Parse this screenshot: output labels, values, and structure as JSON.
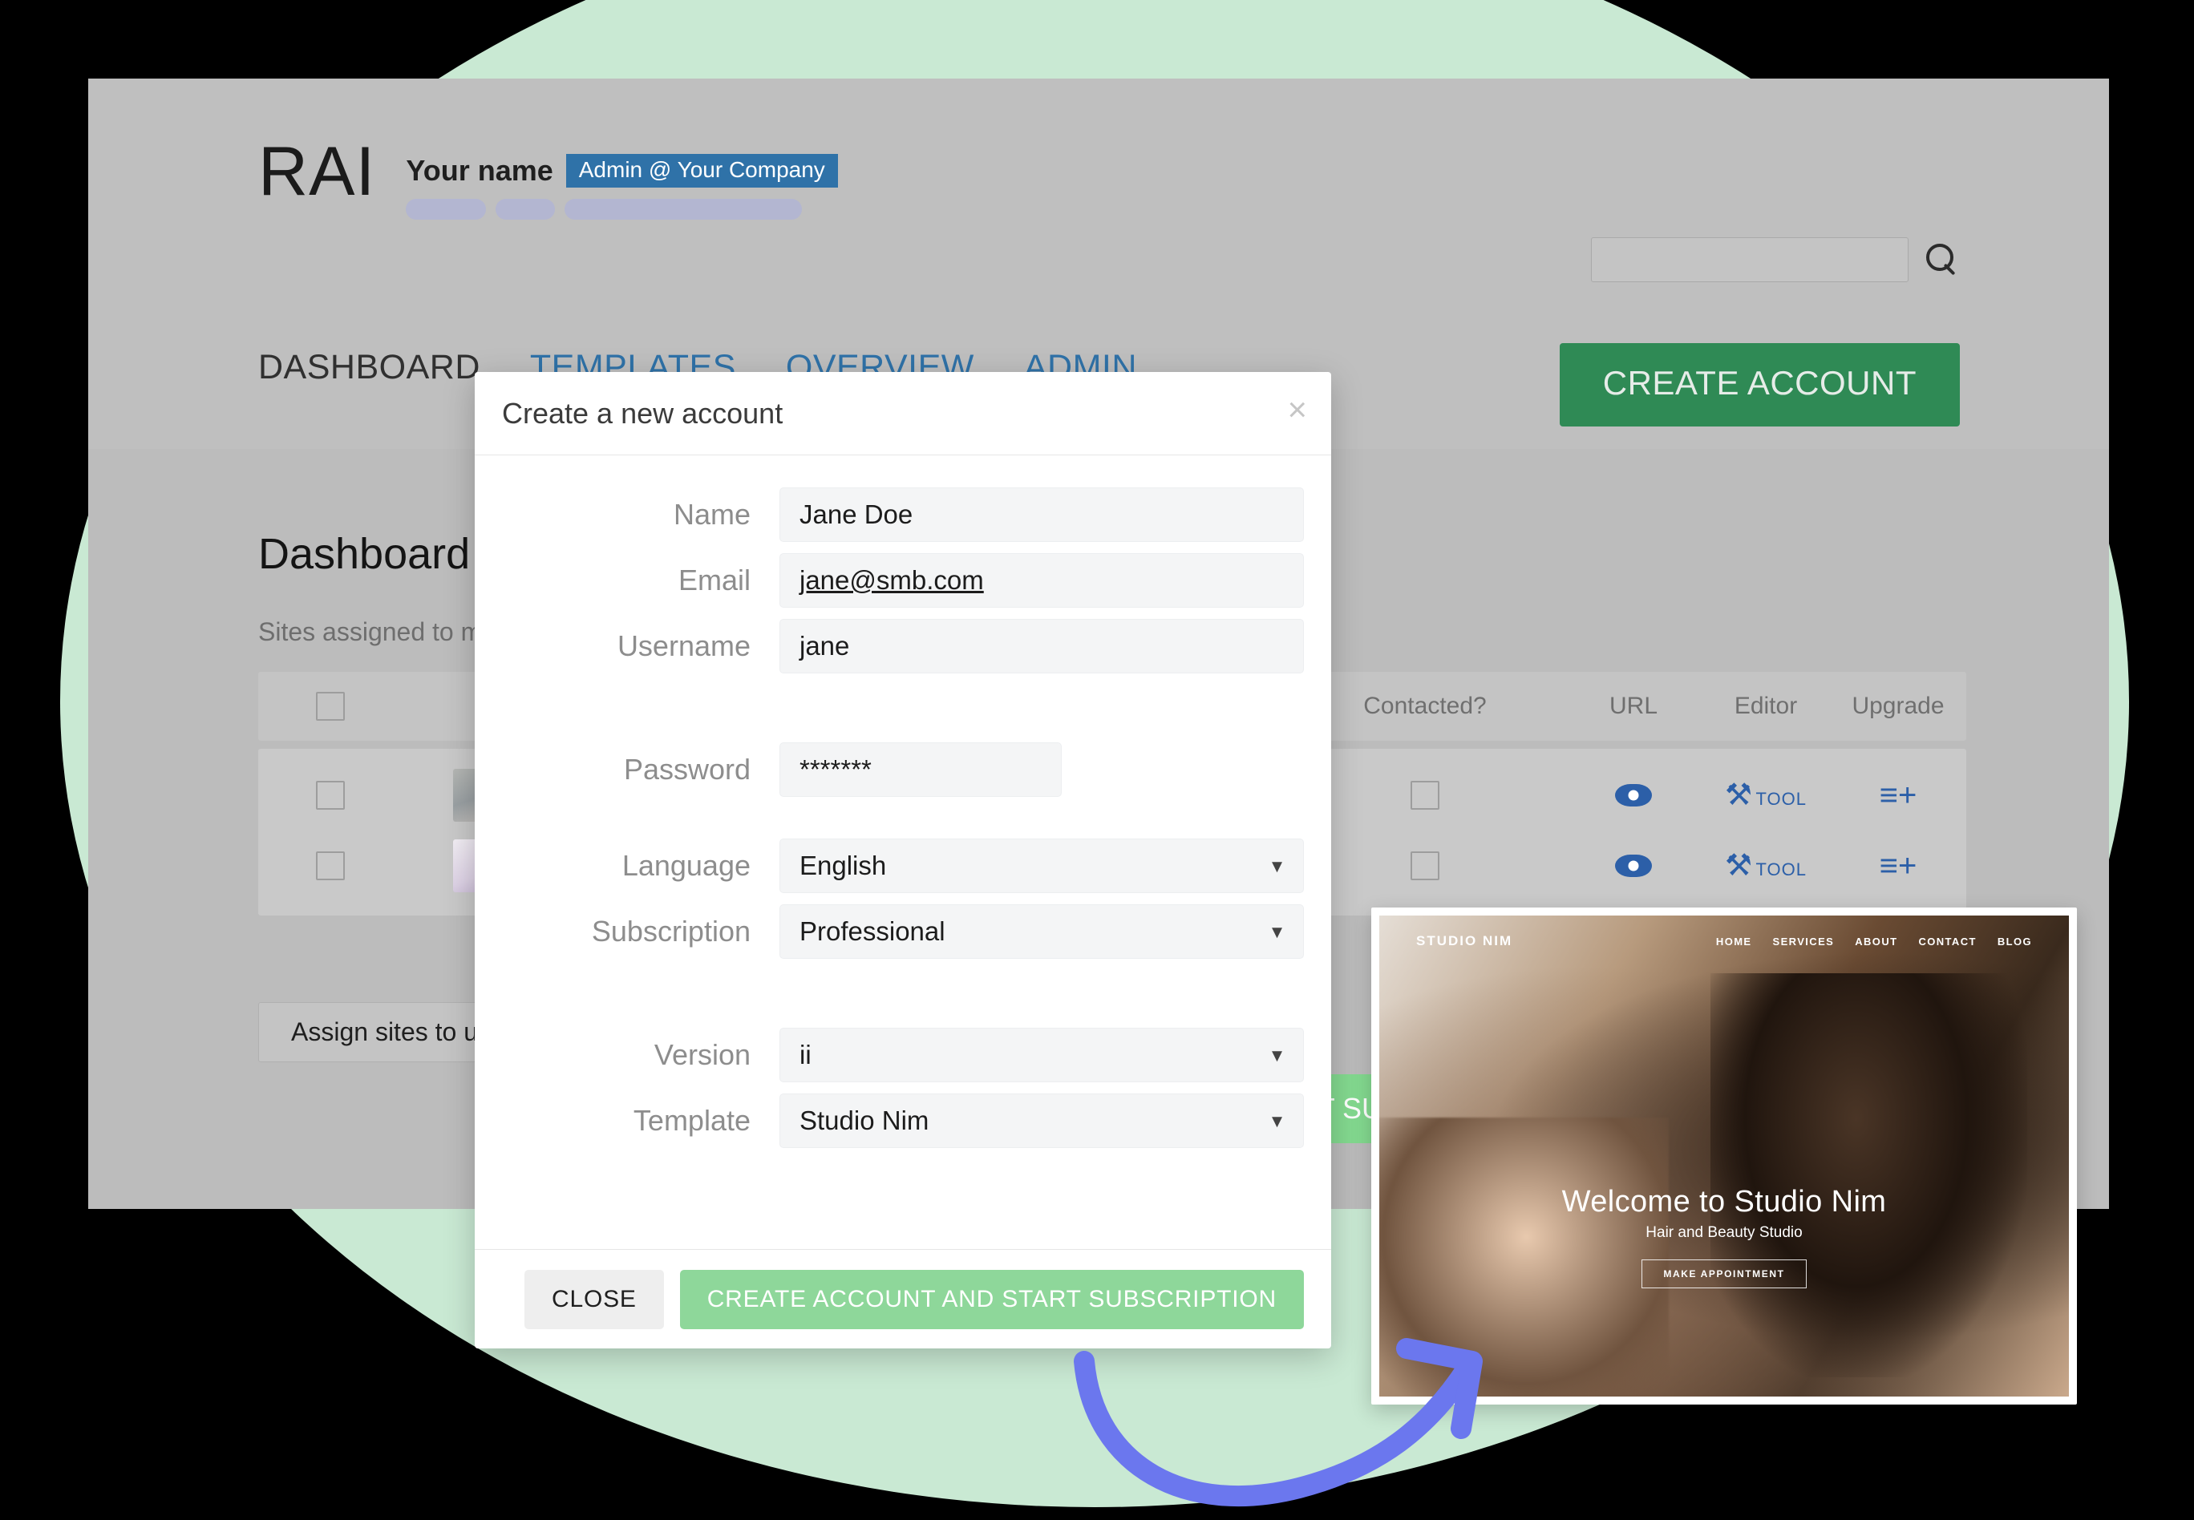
{
  "header": {
    "logo": "RAI",
    "user_name": "Your name",
    "user_role": "Admin @ Your Company",
    "search_placeholder": "",
    "search_value": "",
    "search_icon": "search-icon",
    "create_account_label": "CREATE ACCOUNT"
  },
  "nav": {
    "items": [
      {
        "label": "DASHBOARD",
        "active": true
      },
      {
        "label": "TEMPLATES",
        "active": false
      },
      {
        "label": "OVERVIEW",
        "active": false
      },
      {
        "label": "ADMIN",
        "active": false
      }
    ]
  },
  "dashboard": {
    "title": "Dashboard",
    "subtitle": "Sites assigned to me",
    "assign_button_label": "Assign sites to user",
    "start_subscription_label": "START SUBSCRIPTION",
    "table": {
      "columns": [
        "",
        "",
        "Contacted?",
        "URL",
        "Editor",
        "Upgrade"
      ],
      "rows": [
        {
          "checked": false,
          "thumbnail": "medical-site-thumbnail",
          "contacted": false,
          "url_icon": "eye-icon",
          "editor_icon": "tools-icon",
          "editor_label": "TOOL",
          "upgrade_icon": "list-plus-icon"
        },
        {
          "checked": false,
          "thumbnail": "yoga-site-thumbnail",
          "contacted": false,
          "url_icon": "eye-icon",
          "editor_icon": "tools-icon",
          "editor_label": "TOOL",
          "upgrade_icon": "list-plus-icon"
        }
      ]
    }
  },
  "modal": {
    "title": "Create a new account",
    "close_icon": "close-icon",
    "fields": {
      "name": {
        "label": "Name",
        "value": "Jane Doe"
      },
      "email": {
        "label": "Email",
        "value": "jane@smb.com"
      },
      "username": {
        "label": "Username",
        "value": "jane"
      },
      "password": {
        "label": "Password",
        "value": "*******"
      },
      "language": {
        "label": "Language",
        "value": "English"
      },
      "subscription": {
        "label": "Subscription",
        "value": "Professional"
      },
      "version": {
        "label": "Version",
        "value": "ii"
      },
      "template": {
        "label": "Template",
        "value": "Studio Nim"
      }
    },
    "close_button_label": "CLOSE",
    "submit_button_label": "CREATE ACCOUNT AND START SUBSCRIPTION"
  },
  "preview": {
    "site_logo": "STUDIO NIM",
    "nav_links": [
      "HOME",
      "SERVICES",
      "ABOUT",
      "CONTACT",
      "BLOG"
    ],
    "headline": "Welcome to Studio Nim",
    "subheadline": "Hair and Beauty Studio",
    "cta_label": "MAKE APPOINTMENT"
  },
  "decor": {
    "arrow_icon": "curved-arrow-icon",
    "arrow_color": "#6b77ee",
    "circle_color": "#c9e9d3",
    "accent_green": "#2f8a55",
    "accent_blue": "#2f72a8"
  }
}
